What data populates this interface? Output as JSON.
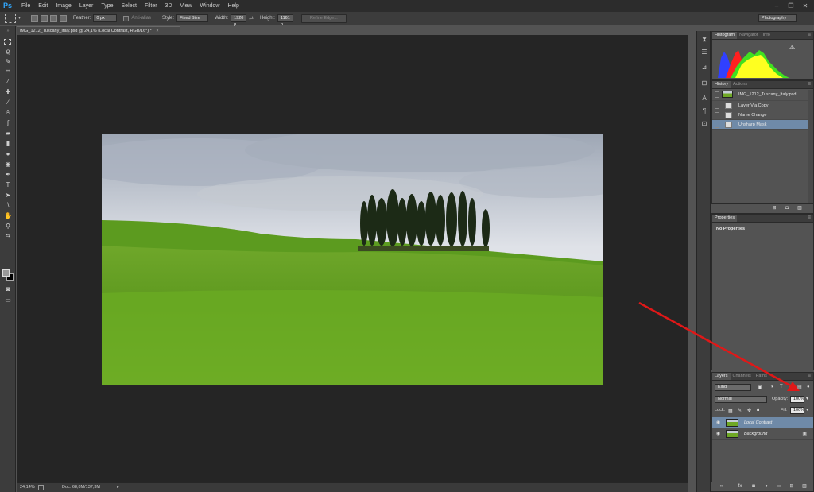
{
  "app": {
    "logo": "Ps"
  },
  "menu": [
    "File",
    "Edit",
    "Image",
    "Layer",
    "Type",
    "Select",
    "Filter",
    "3D",
    "View",
    "Window",
    "Help"
  ],
  "window_controls": {
    "minimize": "–",
    "restore": "❐",
    "close": "✕"
  },
  "options": {
    "feather_label": "Feather:",
    "feather_value": "0 px",
    "antialias_label": "Anti-alias",
    "style_label": "Style:",
    "style_value": "Fixed Size",
    "width_label": "Width:",
    "width_value": "1920 p",
    "height_label": "Height:",
    "height_value": "1161 p",
    "swap": "⇄",
    "refine_edge": "Refine Edge...",
    "workspace": "Photography"
  },
  "document": {
    "tab_title": "IMG_1212_Tuscany_Italy.psd @ 24,1% (Local Contrast, RGB/16*) *",
    "close": "×"
  },
  "status": {
    "zoom": "24,14%",
    "doc": "Doc: 68,8M/137,3M",
    "more": "▸"
  },
  "panels": {
    "top_tabs": [
      "Histogram",
      "Navigator",
      "Info"
    ],
    "history_tabs": [
      "History",
      "Actions"
    ],
    "history_items": [
      {
        "label": "IMG_1212_Tuscany_Italy.psd"
      },
      {
        "label": "Layer Via Copy"
      },
      {
        "label": "Name Change"
      },
      {
        "label": "Unsharp Mask"
      }
    ],
    "properties_tab": "Properties",
    "properties_text": "No Properties",
    "layers_tabs": [
      "Layers",
      "Channels",
      "Paths"
    ],
    "kind_label": "Kind",
    "blend_mode": "Normal",
    "opacity_label": "Opacity:",
    "opacity_value": "100%",
    "lock_label": "Lock:",
    "fill_label": "Fill:",
    "fill_value": "100%",
    "layers": [
      {
        "name": "Local Contrast"
      },
      {
        "name": "Background"
      }
    ]
  },
  "colors": {
    "accent_selected": "#6f8aa8",
    "arrow": "#e01818",
    "ps_blue": "#31a8ff"
  }
}
